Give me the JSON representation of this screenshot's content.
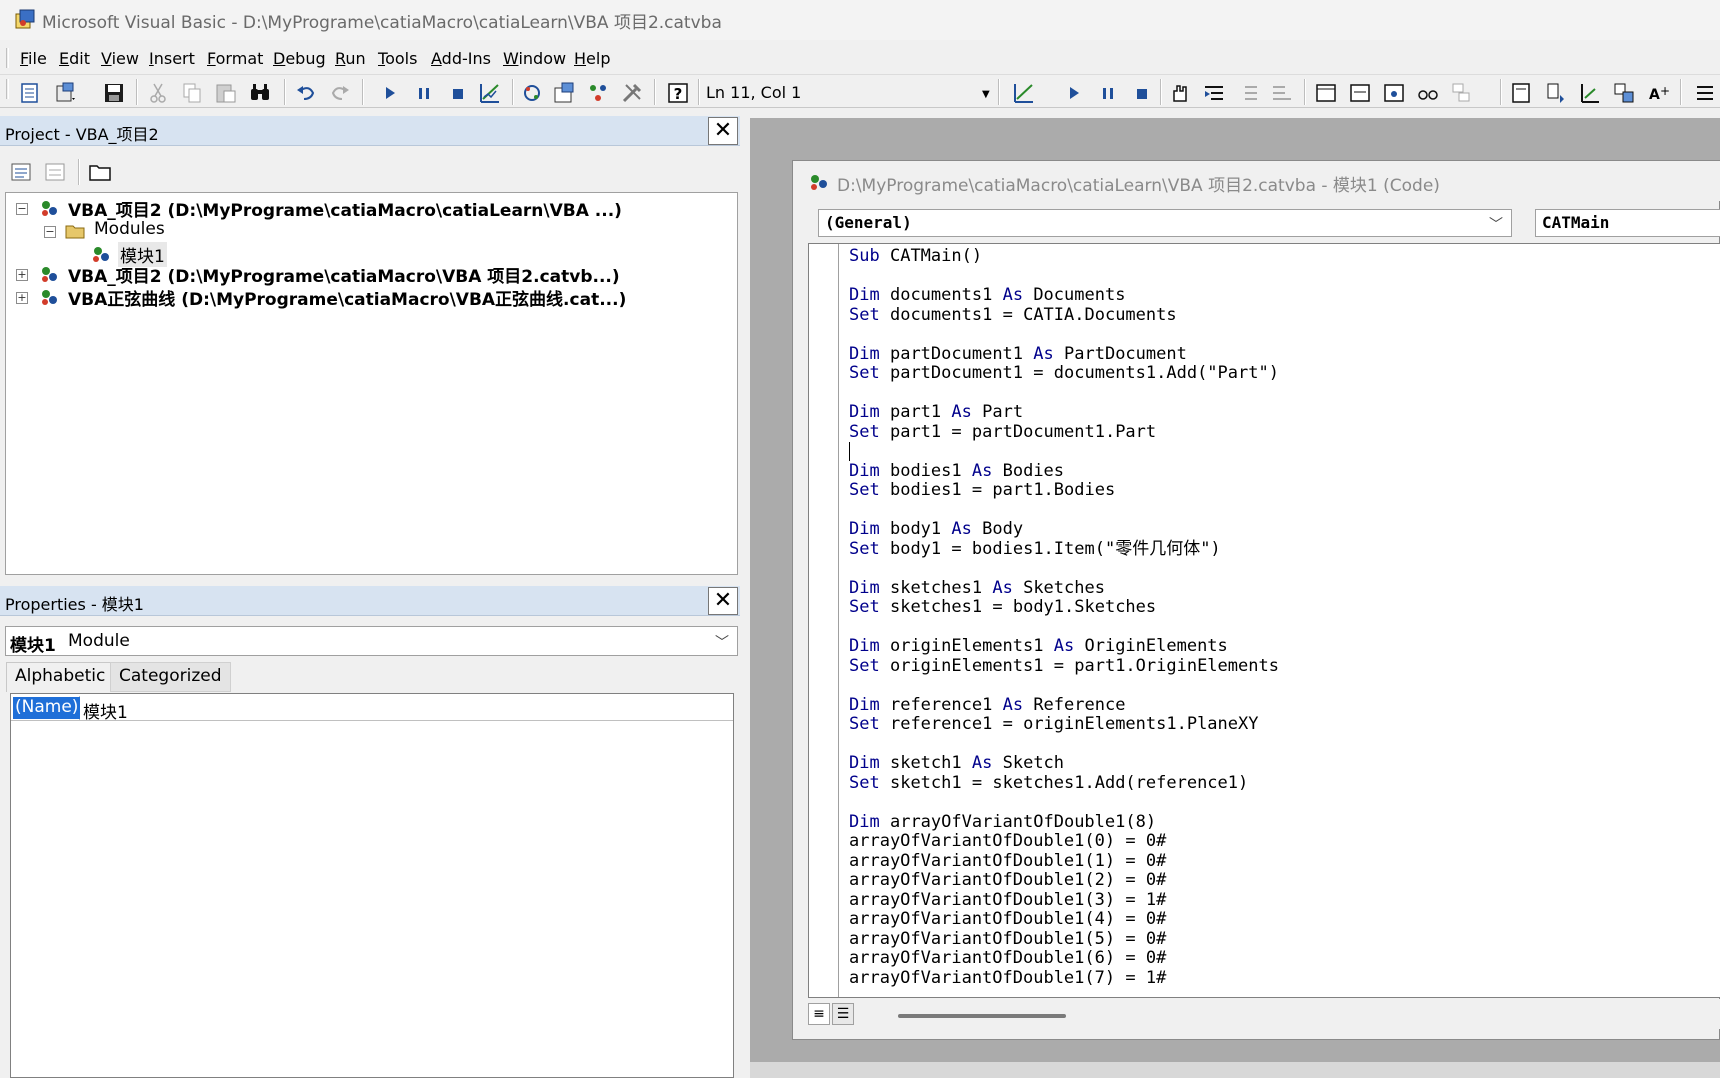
{
  "window": {
    "title": "Microsoft Visual Basic - D:\\MyPrograme\\catiaMacro\\catiaLearn\\VBA 项目2.catvba"
  },
  "menu": [
    "File",
    "Edit",
    "View",
    "Insert",
    "Format",
    "Debug",
    "Run",
    "Tools",
    "Add-Ins",
    "Window",
    "Help"
  ],
  "toolbar": {
    "position": "Ln 11, Col 1",
    "icons": [
      "view-object-icon",
      "insert-module-icon",
      "save-icon",
      "cut-icon",
      "copy-icon",
      "paste-icon",
      "find-icon",
      "undo-icon",
      "redo-icon",
      "run-icon",
      "break-icon",
      "reset-icon",
      "design-mode-icon",
      "project-explorer-icon",
      "properties-window-icon",
      "object-browser-icon",
      "toolbox-icon",
      "help-icon"
    ]
  },
  "project": {
    "title": "Project - VBA_项目2",
    "tree": [
      {
        "label": "VBA_项目2 (D:\\MyPrograme\\catiaMacro\\catiaLearn\\VBA ...)",
        "expanded": true
      },
      {
        "label": "Modules"
      },
      {
        "label": "模块1"
      },
      {
        "label": "VBA_项目2 (D:\\MyPrograme\\catiaMacro\\VBA 项目2.catvb...)",
        "expanded": false
      },
      {
        "label": "VBA正弦曲线 (D:\\MyPrograme\\catiaMacro\\VBA正弦曲线.cat...)",
        "expanded": false
      }
    ]
  },
  "properties": {
    "title": "Properties - 模块1",
    "object_name": "模块1",
    "object_type": "Module",
    "tabs": [
      "Alphabetic",
      "Categorized"
    ],
    "rows": [
      {
        "key": "(Name)",
        "value": "模块1"
      }
    ]
  },
  "code_window": {
    "title": "D:\\MyPrograme\\catiaMacro\\catiaLearn\\VBA 项目2.catvba - 模块1 (Code)",
    "object_combo": "(General)",
    "proc_combo": "CATMain",
    "lines": [
      "Sub CATMain()",
      "",
      "Dim documents1 As Documents",
      "Set documents1 = CATIA.Documents",
      "",
      "Dim partDocument1 As PartDocument",
      "Set partDocument1 = documents1.Add(\"Part\")",
      "",
      "Dim part1 As Part",
      "Set part1 = partDocument1.Part",
      "",
      "Dim bodies1 As Bodies",
      "Set bodies1 = part1.Bodies",
      "",
      "Dim body1 As Body",
      "Set body1 = bodies1.Item(\"零件几何体\")",
      "",
      "Dim sketches1 As Sketches",
      "Set sketches1 = body1.Sketches",
      "",
      "Dim originElements1 As OriginElements",
      "Set originElements1 = part1.OriginElements",
      "",
      "Dim reference1 As Reference",
      "Set reference1 = originElements1.PlaneXY",
      "",
      "Dim sketch1 As Sketch",
      "Set sketch1 = sketches1.Add(reference1)",
      "",
      "Dim arrayOfVariantOfDouble1(8)",
      "arrayOfVariantOfDouble1(0) = 0#",
      "arrayOfVariantOfDouble1(1) = 0#",
      "arrayOfVariantOfDouble1(2) = 0#",
      "arrayOfVariantOfDouble1(3) = 1#",
      "arrayOfVariantOfDouble1(4) = 0#",
      "arrayOfVariantOfDouble1(5) = 0#",
      "arrayOfVariantOfDouble1(6) = 0#",
      "arrayOfVariantOfDouble1(7) = 1#"
    ]
  }
}
